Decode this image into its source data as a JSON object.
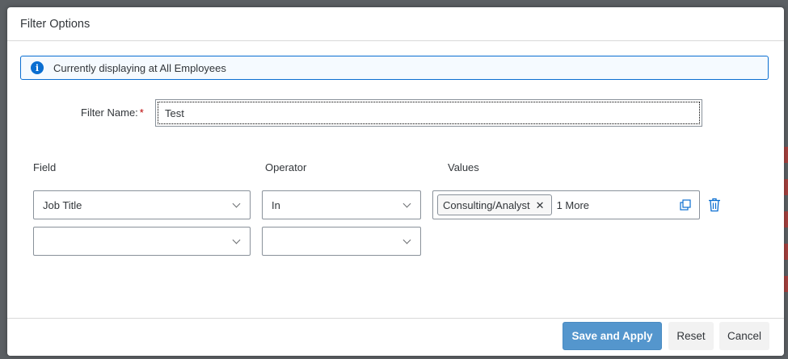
{
  "dialog": {
    "title": "Filter Options",
    "info": "Currently displaying at All Employees"
  },
  "filter_name": {
    "label": "Filter Name:",
    "required_marker": "*",
    "value": "Test"
  },
  "columns": {
    "field": "Field",
    "operator": "Operator",
    "values": "Values"
  },
  "rows": [
    {
      "field": "Job Title",
      "operator": "In",
      "token": "Consulting/Analyst",
      "more": "1 More"
    },
    {
      "field": "",
      "operator": ""
    }
  ],
  "footer": {
    "save_apply": "Save and Apply",
    "reset": "Reset",
    "cancel": "Cancel"
  },
  "colors": {
    "primary": "#5496cd",
    "info_border": "#0a6ed1",
    "required": "#bb0000"
  },
  "icons": {
    "info": "info-icon",
    "chevron": "chevron-down-icon",
    "token_remove": "close-icon",
    "value_help": "value-help-icon",
    "delete": "trash-icon"
  }
}
